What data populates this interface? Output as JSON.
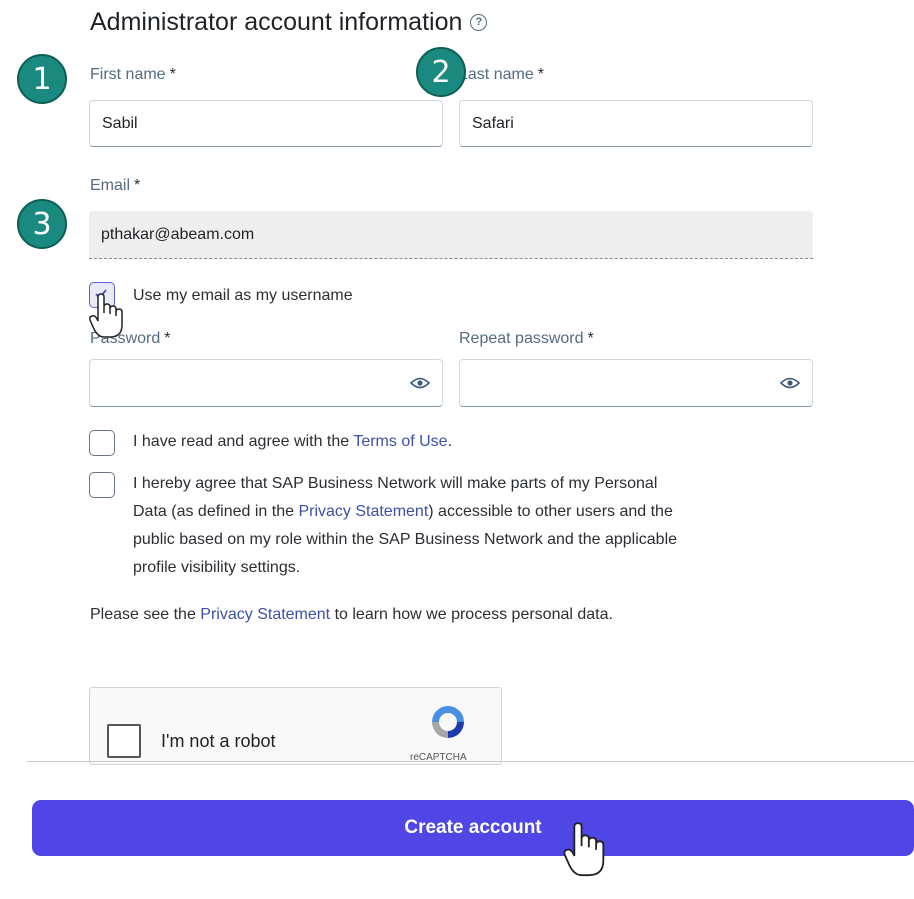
{
  "section": {
    "title": "Administrator account information",
    "help_icon": "question-circle-icon"
  },
  "form": {
    "first_name": {
      "label": "First name",
      "required": "*",
      "value": "Sabil"
    },
    "last_name": {
      "label": "Last name",
      "required": "*",
      "value": "Safari"
    },
    "email": {
      "label": "Email",
      "required": "*",
      "value": "pthakar@abeam.com"
    },
    "use_email_username": {
      "label": "Use my email as my username",
      "checked": true
    },
    "password": {
      "label": "Password",
      "required": "*",
      "value": "",
      "toggle_icon": "eye-icon"
    },
    "repeat_password": {
      "label": "Repeat password",
      "required": "*",
      "value": "",
      "toggle_icon": "eye-icon"
    },
    "terms": {
      "prefix": "I have read and agree with the ",
      "link": "Terms of Use",
      "suffix": ".",
      "checked": false
    },
    "privacy_agree": {
      "prefix": "I hereby agree that SAP Business Network will make parts of my Personal",
      "line2_prefix": "Data (as defined in the ",
      "link": "Privacy Statement",
      "line2_suffix": ") accessible to other users and the",
      "line3": "public based on my role within the SAP Business Network and the applicable",
      "line4": "profile visibility settings.",
      "checked": false
    },
    "privacy_note": {
      "prefix": "Please see the ",
      "link": "Privacy Statement",
      "suffix": " to learn how we process personal data."
    }
  },
  "captcha": {
    "label": "I'm not a robot",
    "brand": "reCAPTCHA"
  },
  "actions": {
    "create_account": "Create account"
  },
  "annotations": {
    "badge_1": "1",
    "badge_2": "2",
    "badge_3": "3",
    "badge_color": "#1a8a80"
  },
  "colors": {
    "primary_button": "#5046e5",
    "link": "#3d50a8"
  }
}
